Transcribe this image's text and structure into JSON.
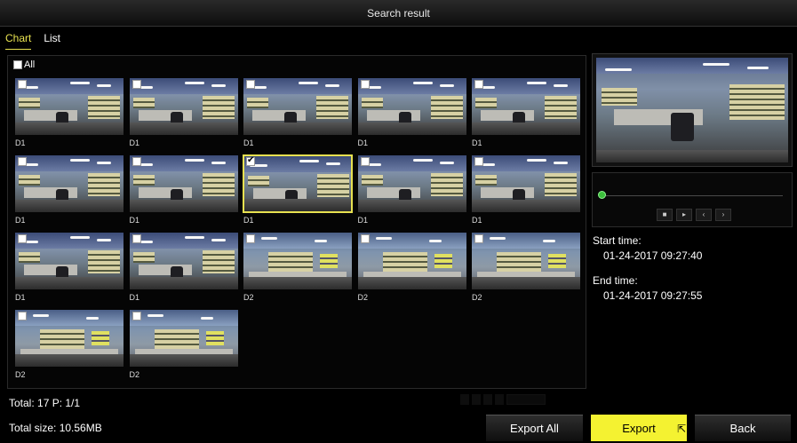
{
  "window": {
    "title": "Search result"
  },
  "tabs": [
    {
      "label": "Chart",
      "active": true
    },
    {
      "label": "List",
      "active": false
    }
  ],
  "select_all": {
    "label": "All",
    "checked": false
  },
  "thumbnails": [
    {
      "label": "D1",
      "checked": false,
      "scene": "d1"
    },
    {
      "label": "D1",
      "checked": false,
      "scene": "d1"
    },
    {
      "label": "D1",
      "checked": false,
      "scene": "d1"
    },
    {
      "label": "D1",
      "checked": false,
      "scene": "d1"
    },
    {
      "label": "D1",
      "checked": false,
      "scene": "d1"
    },
    {
      "label": "D1",
      "checked": false,
      "scene": "d1"
    },
    {
      "label": "D1",
      "checked": false,
      "scene": "d1"
    },
    {
      "label": "D1",
      "checked": true,
      "selected": true,
      "scene": "d1"
    },
    {
      "label": "D1",
      "checked": false,
      "scene": "d1"
    },
    {
      "label": "D1",
      "checked": false,
      "scene": "d1"
    },
    {
      "label": "D1",
      "checked": false,
      "scene": "d1"
    },
    {
      "label": "D1",
      "checked": false,
      "scene": "d1"
    },
    {
      "label": "D2",
      "checked": false,
      "scene": "d2"
    },
    {
      "label": "D2",
      "checked": false,
      "scene": "d2"
    },
    {
      "label": "D2",
      "checked": false,
      "scene": "d2"
    },
    {
      "label": "D2",
      "checked": false,
      "scene": "d2"
    },
    {
      "label": "D2",
      "checked": false,
      "scene": "d2"
    }
  ],
  "player": {
    "buttons": [
      {
        "name": "stop-button",
        "glyph": "■"
      },
      {
        "name": "play-button",
        "glyph": "▸"
      },
      {
        "name": "prev-frame-button",
        "glyph": "‹"
      },
      {
        "name": "next-frame-button",
        "glyph": "›"
      }
    ]
  },
  "info": {
    "start_label": "Start time:",
    "start_value": "01-24-2017 09:27:40",
    "end_label": "End time:",
    "end_value": "01-24-2017 09:27:55"
  },
  "footer": {
    "total": "Total: 17  P: 1/1",
    "size": "Total size: 10.56MB"
  },
  "buttons": {
    "export_all": "Export All",
    "export": "Export",
    "back": "Back"
  },
  "colors": {
    "accent": "#e7e150",
    "export_bg": "#f4f231",
    "progress_dot": "#3cbf3c"
  }
}
